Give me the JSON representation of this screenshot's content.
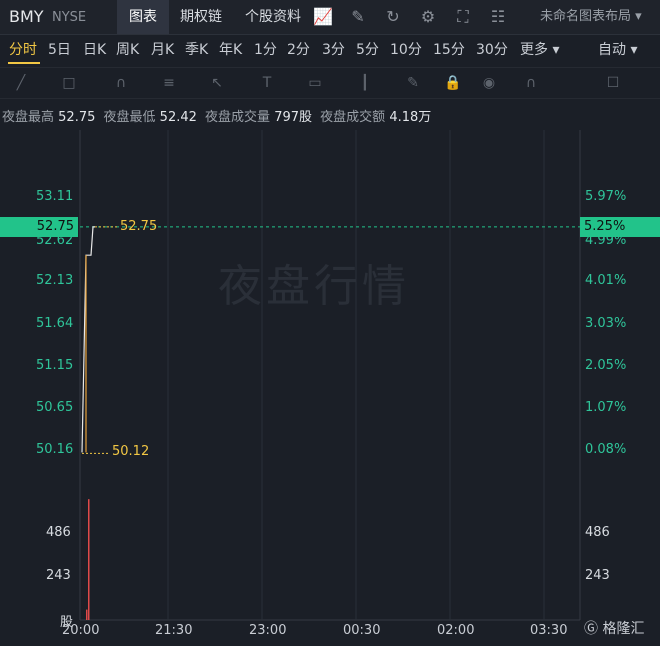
{
  "header": {
    "symbol": "BMY",
    "exchange": "NYSE",
    "tabs": [
      {
        "label": "图表",
        "active": true
      },
      {
        "label": "期权链",
        "active": false
      },
      {
        "label": "个股资料",
        "active": false
      }
    ],
    "icons": [
      "chart-style-icon",
      "draw-icon",
      "refresh-icon",
      "settings-icon",
      "fullscreen-icon",
      "compare-icon"
    ],
    "layout_label": "未命名图表布局"
  },
  "periods": {
    "items": [
      "分时",
      "5日",
      "日K",
      "周K",
      "月K",
      "季K",
      "年K",
      "1分",
      "2分",
      "3分",
      "5分",
      "10分",
      "15分",
      "30分",
      "更多"
    ],
    "active": "分时",
    "auto_label": "自动"
  },
  "drawing_tools": [
    "line-tool-icon",
    "rect-tool-icon",
    "pattern-tool-icon",
    "fib-tool-icon",
    "arrow-tool-icon",
    "text-tool-icon",
    "label-tool-icon",
    "measure-tool-icon",
    "pen-tool-icon",
    "lock-icon",
    "eye-icon",
    "magnet-icon",
    "trash-icon"
  ],
  "stats": {
    "high_label": "夜盘最高",
    "high_value": "52.75",
    "low_label": "夜盘最低",
    "low_value": "52.42",
    "volume_label": "夜盘成交量",
    "volume_value": "797股",
    "turnover_label": "夜盘成交额",
    "turnover_value": "4.18万"
  },
  "watermark": "夜盘行情",
  "chart_data": {
    "type": "line",
    "x_ticks": [
      "20:00",
      "21:30",
      "23:00",
      "00:30",
      "02:00",
      "03:30"
    ],
    "price_axis_left": [
      "53.11",
      "52.62",
      "52.13",
      "51.64",
      "51.15",
      "50.65",
      "50.16"
    ],
    "price_axis_right": [
      "5.97%",
      "4.99%",
      "4.01%",
      "3.03%",
      "2.05%",
      "1.07%",
      "0.08%"
    ],
    "current_price": "52.75",
    "current_pct": "5.25%",
    "high_marker": "52.75",
    "low_marker": "50.12",
    "volume_axis": [
      "486",
      "243"
    ],
    "volume_unit": "股",
    "price_series": [
      {
        "t": "20:00",
        "price": 50.12
      },
      {
        "t": "20:05",
        "price": 52.42
      },
      {
        "t": "20:06",
        "price": 52.42
      },
      {
        "t": "20:07",
        "price": 52.42
      },
      {
        "t": "20:10",
        "price": 52.75
      },
      {
        "t": "20:12",
        "price": 52.75
      }
    ],
    "volume_series": [
      {
        "t": "20:04",
        "v": 50
      },
      {
        "t": "20:05",
        "v": 580
      }
    ],
    "ylim": [
      50.16,
      53.11
    ],
    "colors": {
      "up": "#2fc59a",
      "line": "#e8e8e8",
      "marker": "#f2c744",
      "volume": "#e04a4a"
    }
  },
  "footer": {
    "brand": "格隆汇"
  }
}
